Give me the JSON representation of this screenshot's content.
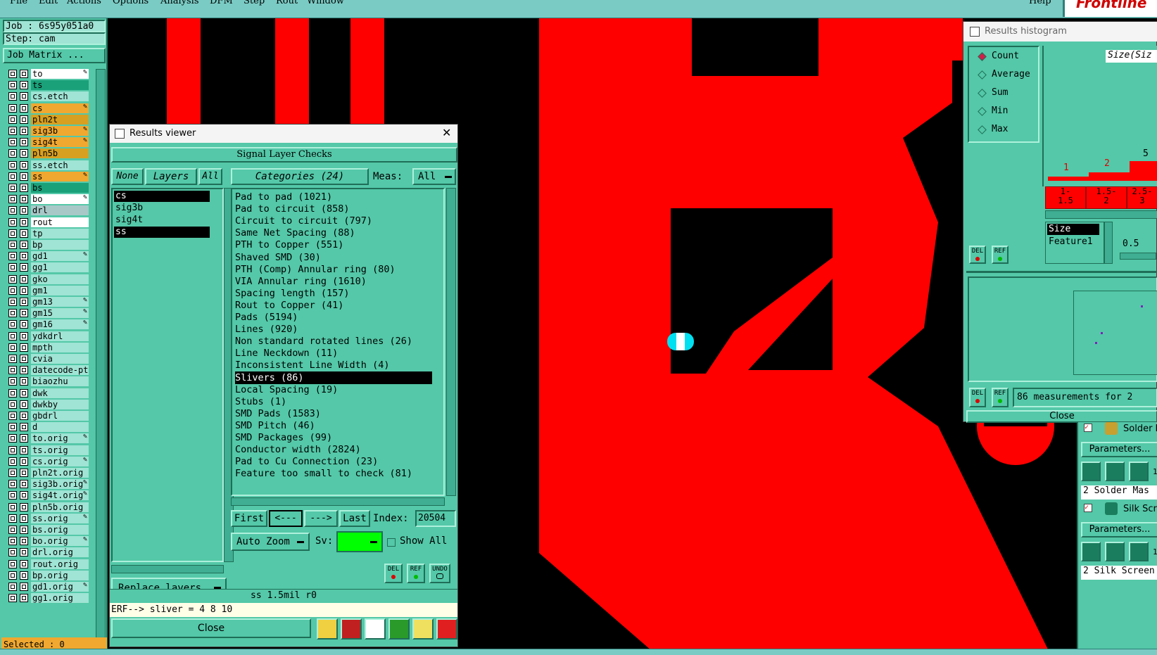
{
  "menubar": {
    "items": [
      "File",
      "Edit",
      "Actions",
      "Options",
      "Analysis",
      "DFM",
      "Step",
      "Rout",
      "Window"
    ],
    "help": "Help",
    "brand": "Frontline"
  },
  "job": {
    "job_label": "Job : 6s95y051a0",
    "step_label": "Step: cam",
    "matrix_button": "Job Matrix ..."
  },
  "layers": [
    {
      "name": "to",
      "color": "#ffffff",
      "edit": true
    },
    {
      "name": "ts",
      "color": "#1aa17a",
      "edit": false
    },
    {
      "name": "cs.etch",
      "color": "#9fe4d4",
      "edit": false
    },
    {
      "name": "cs",
      "color": "#f0a830",
      "edit": true
    },
    {
      "name": "pln2t",
      "color": "#d8a020",
      "edit": false
    },
    {
      "name": "sig3b",
      "color": "#f0a830",
      "edit": true
    },
    {
      "name": "sig4t",
      "color": "#f0a830",
      "edit": true
    },
    {
      "name": "pln5b",
      "color": "#d8a020",
      "edit": false
    },
    {
      "name": "ss.etch",
      "color": "#9fe4d4",
      "edit": false
    },
    {
      "name": "ss",
      "color": "#f0a830",
      "edit": true
    },
    {
      "name": "bs",
      "color": "#1aa17a",
      "edit": false
    },
    {
      "name": "bo",
      "color": "#ffffff",
      "edit": true
    },
    {
      "name": "drl",
      "color": "#a8c8c8",
      "edit": false
    },
    {
      "name": "rout",
      "color": "#ffffff",
      "edit": false
    },
    {
      "name": "tp",
      "color": "#9fe4d4",
      "edit": false
    },
    {
      "name": "bp",
      "color": "#9fe4d4",
      "edit": false
    },
    {
      "name": "gd1",
      "color": "#9fe4d4",
      "edit": true
    },
    {
      "name": "gg1",
      "color": "#9fe4d4",
      "edit": false
    },
    {
      "name": "gko",
      "color": "#9fe4d4",
      "edit": false
    },
    {
      "name": "gm1",
      "color": "#9fe4d4",
      "edit": false
    },
    {
      "name": "gm13",
      "color": "#9fe4d4",
      "edit": true
    },
    {
      "name": "gm15",
      "color": "#9fe4d4",
      "edit": true
    },
    {
      "name": "gm16",
      "color": "#9fe4d4",
      "edit": true
    },
    {
      "name": "ydkdrl",
      "color": "#9fe4d4",
      "edit": false
    },
    {
      "name": "mpth",
      "color": "#9fe4d4",
      "edit": false
    },
    {
      "name": "cvia",
      "color": "#9fe4d4",
      "edit": false
    },
    {
      "name": "datecode-pt",
      "color": "#9fe4d4",
      "edit": false
    },
    {
      "name": "biaozhu",
      "color": "#9fe4d4",
      "edit": false
    },
    {
      "name": "dwk",
      "color": "#9fe4d4",
      "edit": false
    },
    {
      "name": "dwkby",
      "color": "#9fe4d4",
      "edit": false
    },
    {
      "name": "gbdrl",
      "color": "#9fe4d4",
      "edit": false
    },
    {
      "name": "d",
      "color": "#9fe4d4",
      "edit": false
    },
    {
      "name": "to.orig",
      "color": "#9fe4d4",
      "edit": true
    },
    {
      "name": "ts.orig",
      "color": "#9fe4d4",
      "edit": false
    },
    {
      "name": "cs.orig",
      "color": "#9fe4d4",
      "edit": true
    },
    {
      "name": "pln2t.orig",
      "color": "#9fe4d4",
      "edit": false
    },
    {
      "name": "sig3b.orig",
      "color": "#9fe4d4",
      "edit": true
    },
    {
      "name": "sig4t.orig",
      "color": "#9fe4d4",
      "edit": true
    },
    {
      "name": "pln5b.orig",
      "color": "#9fe4d4",
      "edit": false
    },
    {
      "name": "ss.orig",
      "color": "#9fe4d4",
      "edit": true
    },
    {
      "name": "bs.orig",
      "color": "#9fe4d4",
      "edit": false
    },
    {
      "name": "bo.orig",
      "color": "#9fe4d4",
      "edit": true
    },
    {
      "name": "drl.orig",
      "color": "#9fe4d4",
      "edit": false
    },
    {
      "name": "rout.orig",
      "color": "#9fe4d4",
      "edit": false
    },
    {
      "name": "bp.orig",
      "color": "#9fe4d4",
      "edit": false
    },
    {
      "name": "gd1.orig",
      "color": "#9fe4d4",
      "edit": true
    },
    {
      "name": "gg1.orig",
      "color": "#9fe4d4",
      "edit": false
    }
  ],
  "selected_label": "Selected : 0",
  "results_viewer": {
    "title": "Results viewer",
    "close_x": "✕",
    "header": "Signal Layer Checks",
    "none_btn": "None",
    "layers_btn": "Layers",
    "all_btn": "All",
    "categories_btn": "Categories (24)",
    "meas_label": "Meas:",
    "meas_value": "All",
    "layer_list": [
      "cs",
      "sig3b",
      "sig4t",
      "ss"
    ],
    "categories": [
      "Pad to pad (1021)",
      "Pad to circuit (858)",
      "Circuit to circuit (797)",
      "Same Net Spacing (88)",
      "PTH to Copper (551)",
      "Shaved SMD (30)",
      "PTH (Comp) Annular ring (80)",
      "VIA Annular ring (1610)",
      "Spacing length (157)",
      "Rout to Copper (41)",
      "Pads (5194)",
      "Lines (920)",
      "Non standard rotated lines (26)",
      "Line Neckdown (11)",
      "Inconsistent Line Width (4)",
      "Slivers (86)",
      "Local Spacing (19)",
      "Stubs (1)",
      "SMD Pads (1583)",
      "SMD Pitch (46)",
      "SMD Packages (99)",
      "Conductor width (2824)",
      "Pad to Cu Connection (23)",
      "Feature too small to check (81)"
    ],
    "selected_category": "Slivers (86)",
    "nav": {
      "first": "First",
      "prev": "<---",
      "next": "--->",
      "last": "Last",
      "index_label": "Index:",
      "index_value": "20504"
    },
    "auto_zoom": "Auto Zoom",
    "sv_label": "Sv:",
    "show_all": "Show All",
    "replace_layers": "Replace layers",
    "del": "DEL",
    "ref": "REF",
    "undo": "UNDO",
    "status": "ss 1.5mil  r0",
    "erf_line": "ERF--> sliver = 4 8 10",
    "close": "Close"
  },
  "histogram": {
    "title": "Results histogram",
    "modes": [
      "Count",
      "Average",
      "Sum",
      "Min",
      "Max"
    ],
    "selected_mode": "Count",
    "size_label": "Size(Siz",
    "bar_labels": [
      "1",
      "2",
      "5"
    ],
    "bin_labels": [
      "1-\n1.5",
      "1.5-\n2",
      "2.5-\n3"
    ],
    "list_items": [
      "Size",
      "Feature1"
    ],
    "slider_value": "0.5",
    "measurements": "86 measurements for 2",
    "close": "Close",
    "del": "DEL",
    "ref": "REF"
  },
  "right_panel": {
    "solder_label": "Solder M",
    "params1": "Parameters...",
    "solder_row": "2 Solder Mas",
    "silk_label": "Silk Scr",
    "params2": "Parameters...",
    "silk_row": "2 Silk Screen",
    "count1": "1",
    "count2": "1"
  },
  "colors": {
    "teal": "#54c8a8",
    "copper": "#ff0000",
    "canvas": "#000000",
    "highlight": "#00e0f0"
  }
}
